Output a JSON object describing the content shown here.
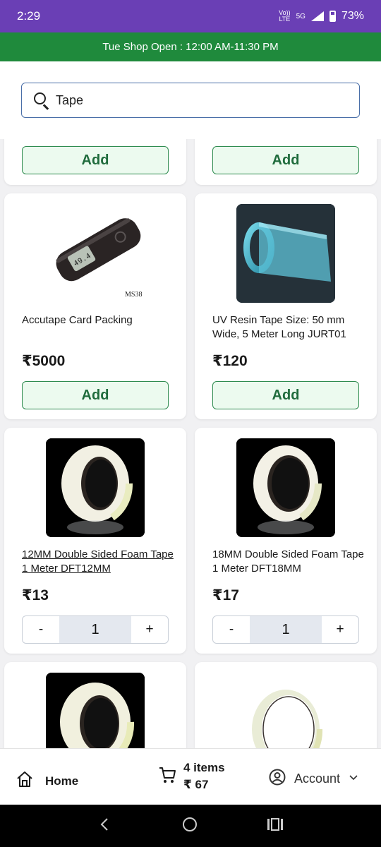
{
  "status_bar": {
    "time": "2:29",
    "network_top": "Vo))",
    "network_bottom": "LTE",
    "network_gen": "5G",
    "battery": "73%"
  },
  "banner": {
    "text": "Tue Shop Open : 12:00 AM-11:30 PM"
  },
  "search": {
    "value": "Tape",
    "placeholder": ""
  },
  "products": [
    {
      "name": "",
      "price": "",
      "action_label": "Add"
    },
    {
      "name": "",
      "price": "",
      "action_label": "Add"
    },
    {
      "name": "Accutape Card Packing",
      "price": "₹5000",
      "action_label": "Add",
      "image_caption": "MS38",
      "device_screen": "49.4"
    },
    {
      "name": "UV Resin Tape Size: 50 mm Wide, 5 Meter Long JURT01",
      "price": "₹120",
      "action_label": "Add"
    },
    {
      "name": "12MM Double Sided Foam Tape 1 Meter DFT12MM",
      "price": "₹13",
      "quantity": "1",
      "minus": "-",
      "plus": "+"
    },
    {
      "name": "18MM Double Sided Foam Tape 1 Meter DFT18MM",
      "price": "₹17",
      "quantity": "1",
      "minus": "-",
      "plus": "+"
    },
    {
      "name": "",
      "price": ""
    },
    {
      "name": "",
      "price": ""
    }
  ],
  "bottom_nav": {
    "home_label": "Home",
    "cart_items": "4 items",
    "cart_total": "₹ 67",
    "account_label": "Account"
  },
  "colors": {
    "status_bar": "#6a3fb5",
    "banner": "#1f8a3c",
    "add_button_border": "#2e8b4f",
    "add_button_bg": "#ecfaef",
    "search_border": "#4a6fa8"
  }
}
